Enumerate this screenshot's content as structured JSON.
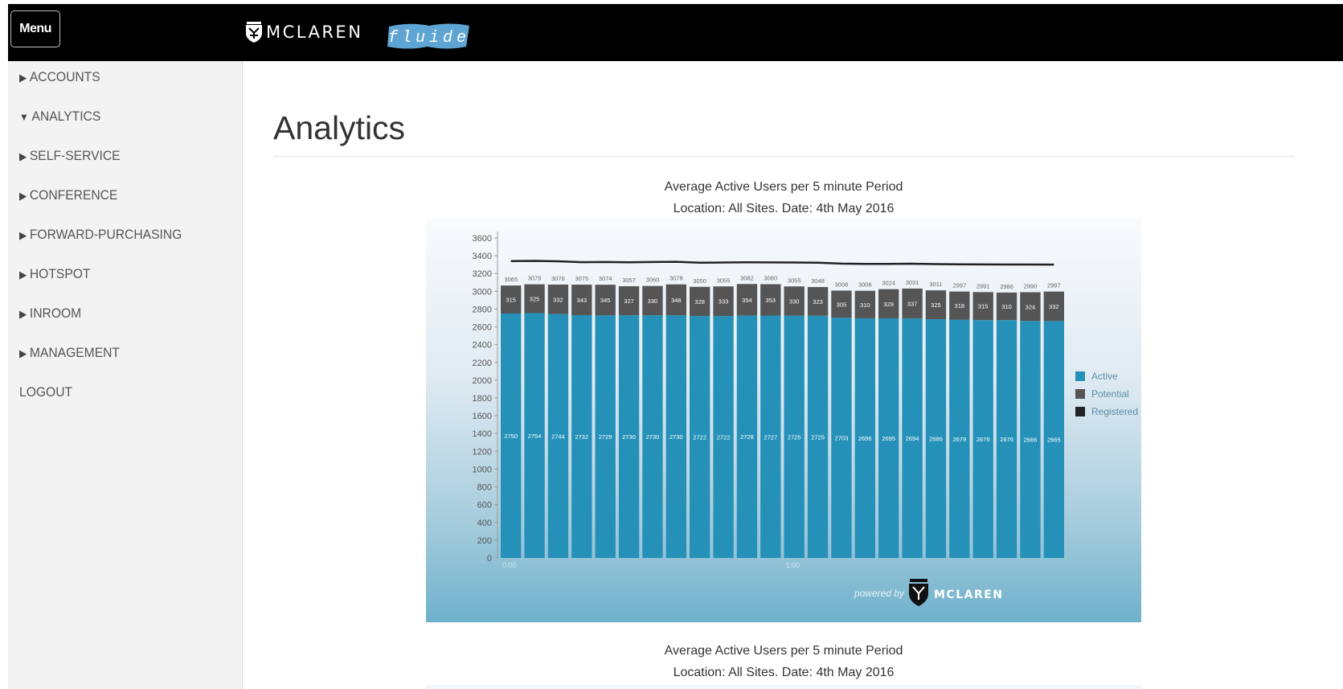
{
  "header": {
    "menu_label": "Menu",
    "brand_name": "MCLAREN",
    "sub_brand": "fluide"
  },
  "sidebar": {
    "items": [
      {
        "arrow": "▶",
        "label": "ACCOUNTS"
      },
      {
        "arrow": "▼",
        "label": "ANALYTICS"
      },
      {
        "arrow": "▶",
        "label": "SELF-SERVICE"
      },
      {
        "arrow": "▶",
        "label": "CONFERENCE"
      },
      {
        "arrow": "▶",
        "label": "FORWARD-PURCHASING"
      },
      {
        "arrow": "▶",
        "label": "HOTSPOT"
      },
      {
        "arrow": "▶",
        "label": "INROOM"
      },
      {
        "arrow": "▶",
        "label": "MANAGEMENT"
      },
      {
        "arrow": "",
        "label": "LOGOUT"
      }
    ]
  },
  "main": {
    "title": "Analytics"
  },
  "chart_data": [
    {
      "type": "bar",
      "stacked": true,
      "title": "Average Active Users per 5 minute Period",
      "subtitle": "Location: All Sites. Date: 4th May 2016",
      "xlabel": "",
      "ylabel": "",
      "ylim": [
        0,
        3600
      ],
      "yticks": [
        0,
        200,
        400,
        600,
        800,
        1000,
        1200,
        1400,
        1600,
        1800,
        2000,
        2200,
        2400,
        2600,
        2800,
        3000,
        3200,
        3400,
        3600
      ],
      "x_tick_labels": [
        {
          "index": 0,
          "label": "0:00"
        },
        {
          "index": 12,
          "label": "1:00"
        }
      ],
      "series": [
        {
          "name": "Active",
          "color": "#2591b9",
          "values": [
            2750,
            2754,
            2744,
            2732,
            2729,
            2730,
            2730,
            2730,
            2722,
            2722,
            2728,
            2727,
            2725,
            2725,
            2703,
            2696,
            2695,
            2694,
            2686,
            2679,
            2676,
            2676,
            2666,
            2665
          ]
        },
        {
          "name": "Potential",
          "color": "#555555",
          "values": [
            315,
            325,
            332,
            343,
            345,
            327,
            330,
            348,
            328,
            333,
            354,
            353,
            330,
            323,
            305,
            310,
            329,
            337,
            325,
            318,
            315,
            310,
            324,
            332
          ]
        }
      ],
      "totals": [
        3065,
        3079,
        3076,
        3075,
        3074,
        3057,
        3060,
        3078,
        3050,
        3055,
        3082,
        3080,
        3055,
        3048,
        3008,
        3006,
        3024,
        3031,
        3011,
        2997,
        2991,
        2986,
        2990,
        2997
      ],
      "registered": {
        "name": "Registered",
        "color": "#222222",
        "values": [
          3340,
          3342,
          3338,
          3328,
          3330,
          3326,
          3330,
          3332,
          3322,
          3324,
          3326,
          3325,
          3324,
          3322,
          3312,
          3308,
          3308,
          3310,
          3306,
          3304,
          3303,
          3302,
          3302,
          3300
        ]
      },
      "legend": [
        "Active",
        "Potential",
        "Registered"
      ],
      "legend_position": "right",
      "watermark": {
        "prefix": "powered by",
        "brand": "MCLAREN"
      }
    },
    {
      "type": "bar",
      "title": "Average Active Users per 5 minute Period",
      "subtitle": "Location: All Sites. Date: 4th May 2016"
    }
  ]
}
